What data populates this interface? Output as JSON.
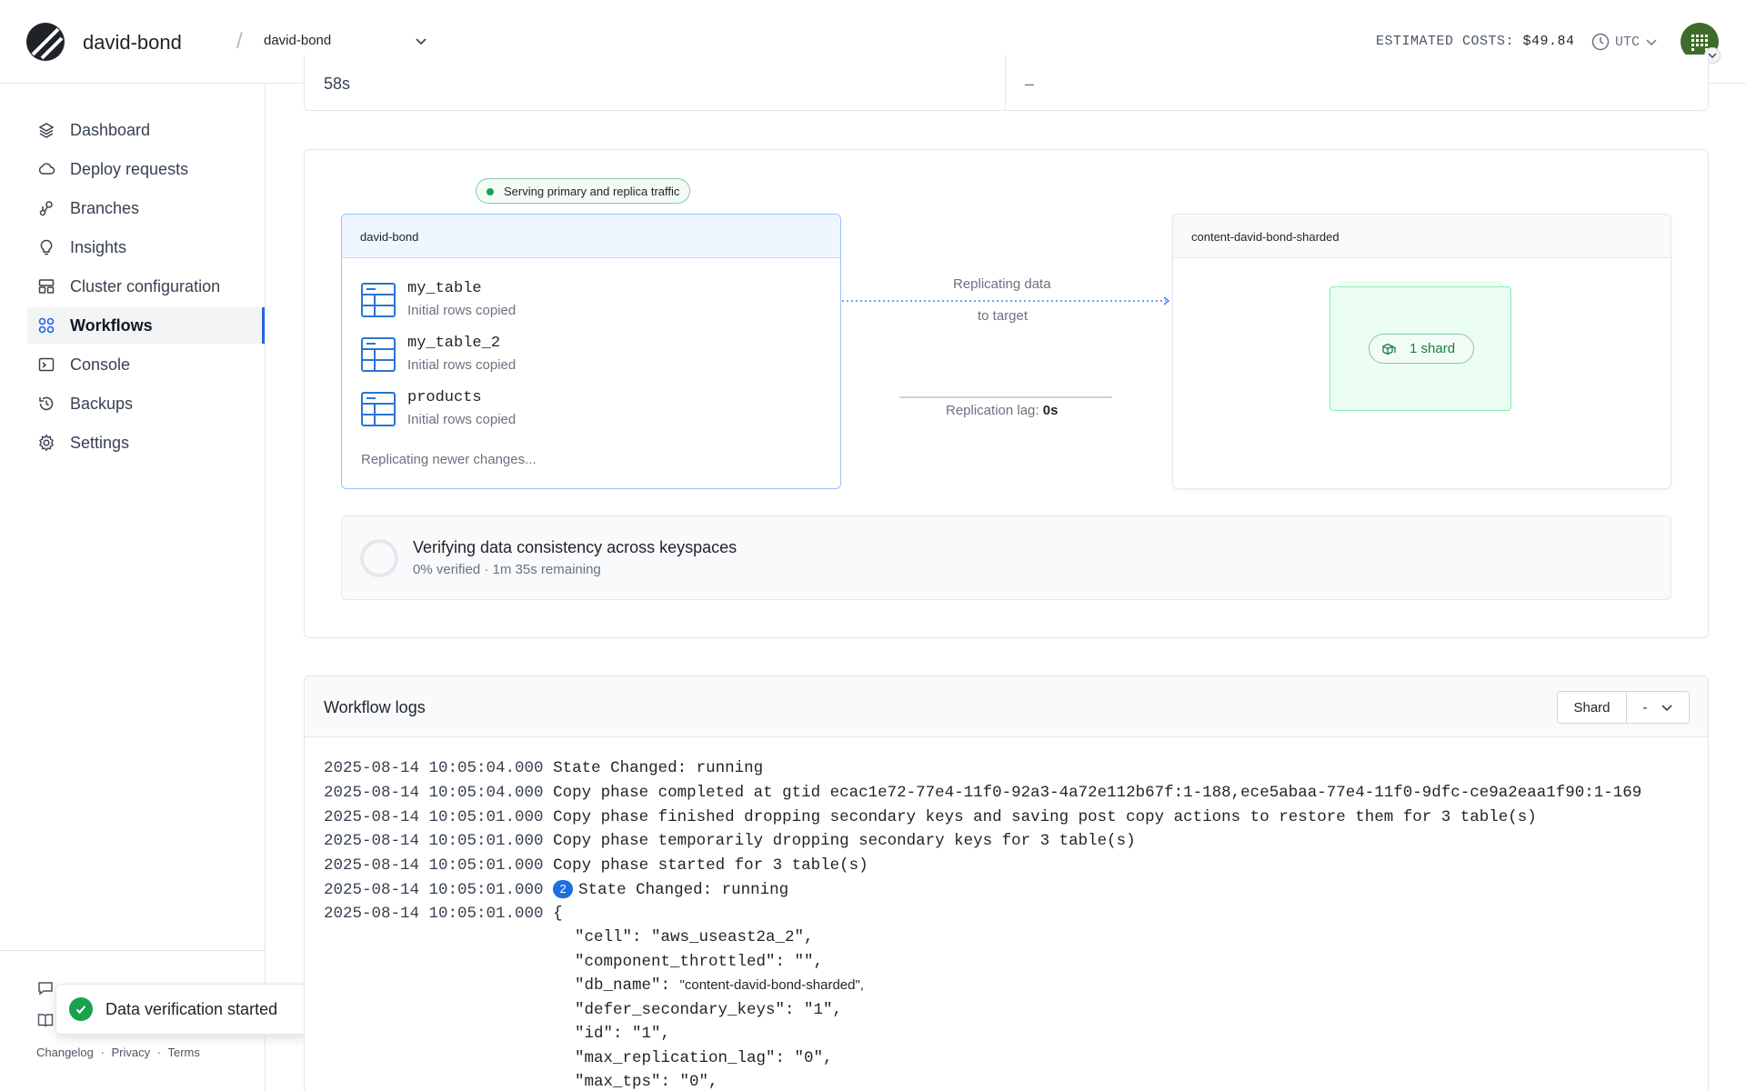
{
  "header": {
    "org_name": "david-bond",
    "database_select": "david-bond",
    "estimated_costs_label": "ESTIMATED COSTS:",
    "estimated_costs_value": "$49.84",
    "timezone": "UTC"
  },
  "sidebar": {
    "items": [
      {
        "label": "Dashboard",
        "icon": "layers-icon"
      },
      {
        "label": "Deploy requests",
        "icon": "cloud-icon"
      },
      {
        "label": "Branches",
        "icon": "branch-icon"
      },
      {
        "label": "Insights",
        "icon": "bulb-icon"
      },
      {
        "label": "Cluster configuration",
        "icon": "cluster-icon"
      },
      {
        "label": "Workflows",
        "icon": "workflow-icon",
        "active": true
      },
      {
        "label": "Console",
        "icon": "terminal-icon"
      },
      {
        "label": "Backups",
        "icon": "backup-icon"
      },
      {
        "label": "Settings",
        "icon": "gear-icon"
      }
    ],
    "footer_links": [
      "Changelog",
      "Privacy",
      "Terms"
    ],
    "footer_separator": "·"
  },
  "toast": {
    "message": "Data verification started"
  },
  "top_card": {
    "left_value": "58s",
    "right_value": "–"
  },
  "diagram": {
    "serving_badge": "Serving primary and replica traffic",
    "source": {
      "name": "david-bond",
      "tables": [
        {
          "name": "my_table",
          "status": "Initial rows copied"
        },
        {
          "name": "my_table_2",
          "status": "Initial rows copied"
        },
        {
          "name": "products",
          "status": "Initial rows copied"
        }
      ],
      "footer": "Replicating newer changes..."
    },
    "replication": {
      "label_line1": "Replicating data",
      "label_line2": "to target",
      "lag_label": "Replication lag:",
      "lag_value": "0s"
    },
    "target": {
      "name": "content-david-bond-sharded",
      "shards": "1 shard"
    },
    "verification": {
      "title": "Verifying data consistency across keyspaces",
      "subtitle": "0% verified · 1m 35s remaining"
    }
  },
  "logs": {
    "title": "Workflow logs",
    "shard_label": "Shard",
    "shard_value": "-",
    "entries": [
      {
        "ts": "2025-08-14 10:05:04.000",
        "msg": "State Changed: running"
      },
      {
        "ts": "2025-08-14 10:05:04.000",
        "msg": "Copy phase completed at gtid ecac1e72-77e4-11f0-92a3-4a72e112b67f:1-188,ece5abaa-77e4-11f0-9dfc-ce9a2eaa1f90:1-169"
      },
      {
        "ts": "2025-08-14 10:05:01.000",
        "msg": "Copy phase finished dropping secondary keys and saving post copy actions to restore them for 3 table(s)"
      },
      {
        "ts": "2025-08-14 10:05:01.000",
        "msg": "Copy phase temporarily dropping secondary keys for 3 table(s)"
      },
      {
        "ts": "2025-08-14 10:05:01.000",
        "msg": "Copy phase started for 3 table(s)"
      },
      {
        "ts": "2025-08-14 10:05:01.000",
        "badge": "2",
        "msg": "State Changed: running"
      },
      {
        "ts": "2025-08-14 10:05:01.000",
        "msg": "{"
      }
    ],
    "json_lines": [
      "\"cell\": \"aws_useast2a_2\",",
      "\"component_throttled\": \"\",",
      "\"db_name\": ",
      "\"defer_secondary_keys\": \"1\",",
      "\"id\": \"1\",",
      "\"max_replication_lag\": \"0\",",
      "\"max_tps\": \"0\","
    ],
    "db_name_value": "\"content-david-bond-sharded\","
  }
}
